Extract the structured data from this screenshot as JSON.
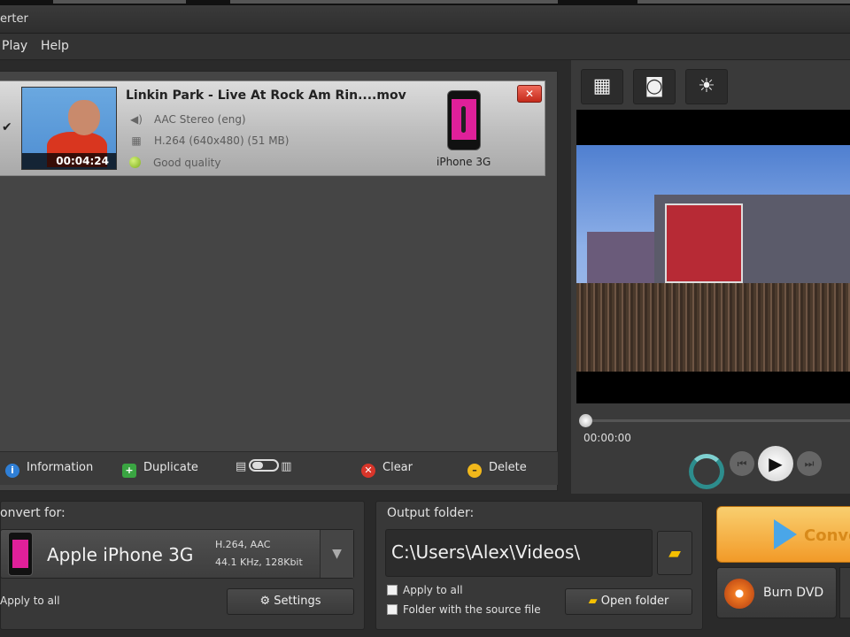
{
  "window": {
    "title": "erter"
  },
  "menu": [
    "Play",
    "Help"
  ],
  "file": {
    "checked": "✔",
    "title": "Linkin Park - Live At Rock Am Rin....mov",
    "duration": "00:04:24",
    "audio": "AAC Stereo (eng)",
    "video": "H.264 (640x480) (51 MB)",
    "quality": "Good quality",
    "target_device": "iPhone 3G",
    "remove_icon": "close-icon"
  },
  "list_toolbar": {
    "information": "Information",
    "duplicate": "Duplicate",
    "clear": "Clear",
    "delete": "Delete"
  },
  "player": {
    "tools": [
      "grid-icon",
      "snapshot-icon",
      "brightness-icon"
    ],
    "current_time": "00:00:00",
    "progress": 0
  },
  "convert_for": {
    "label": "onvert for:",
    "profile": "Apple iPhone 3G",
    "codec": "H.264, AAC",
    "audio_spec": "44.1 KHz, 128Kbit",
    "apply_all": "Apply to all",
    "settings": "Settings"
  },
  "output": {
    "label": "Output folder:",
    "path": "C:\\Users\\Alex\\Videos\\",
    "apply_all": "Apply to all",
    "source_folder": "Folder with the source file",
    "open_folder": "Open folder"
  },
  "actions": {
    "convert": "Conve",
    "burn_dvd": "Burn DVD"
  },
  "colors": {
    "accent_orange": "#f29a28",
    "play_blue": "#4aa6e8",
    "device_pink": "#e0209a"
  }
}
